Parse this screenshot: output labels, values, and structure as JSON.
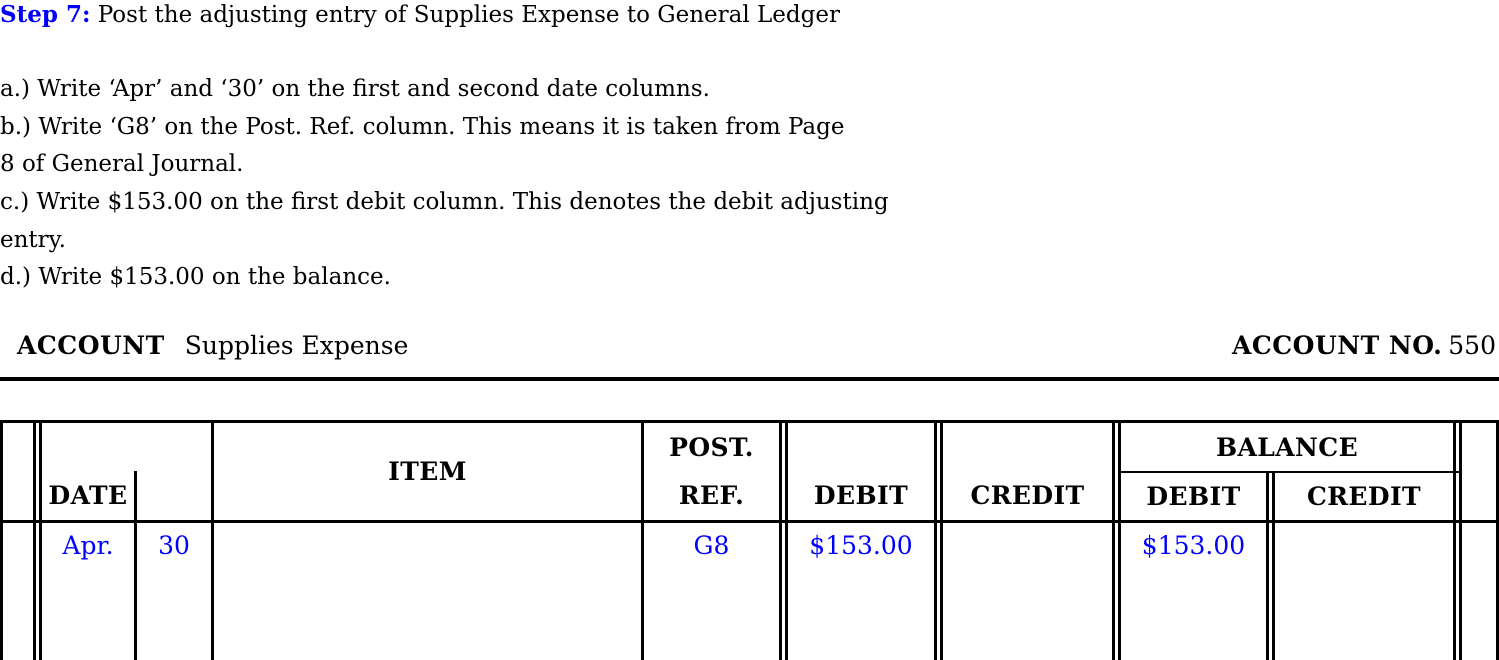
{
  "step": {
    "label": "Step 7:",
    "text": "Post the adjusting entry of Supplies Expense to General Ledger"
  },
  "instructions": [
    "a.)  Write ‘Apr’ and ‘30’ on the first and second date columns.",
    "b.)  Write ‘G8’ on the Post. Ref. column.  This means it is taken from Page",
    "8 of General Journal.",
    "c.)  Write $153.00 on the first debit column.  This denotes the debit adjusting",
    "entry.",
    "d.)  Write $153.00 on the balance."
  ],
  "account": {
    "label": "ACCOUNT",
    "name": "Supplies Expense",
    "no_label": "ACCOUNT NO.",
    "no_value": "550"
  },
  "ledger": {
    "headers": {
      "date": "DATE",
      "item": "ITEM",
      "post_ref_line1": "POST.",
      "post_ref_line2": "REF.",
      "debit": "DEBIT",
      "credit": "CREDIT",
      "balance": "BALANCE",
      "balance_debit": "DEBIT",
      "balance_credit": "CREDIT"
    },
    "rows": [
      {
        "date_month": "Apr.",
        "date_day": "30",
        "item": "",
        "post_ref": "G8",
        "debit": "$153.00",
        "credit": "",
        "balance_debit": "$153.00",
        "balance_credit": ""
      }
    ]
  },
  "colors": {
    "entry": "#0000ff",
    "rule": "#000000",
    "step_label": "#0000ff"
  }
}
